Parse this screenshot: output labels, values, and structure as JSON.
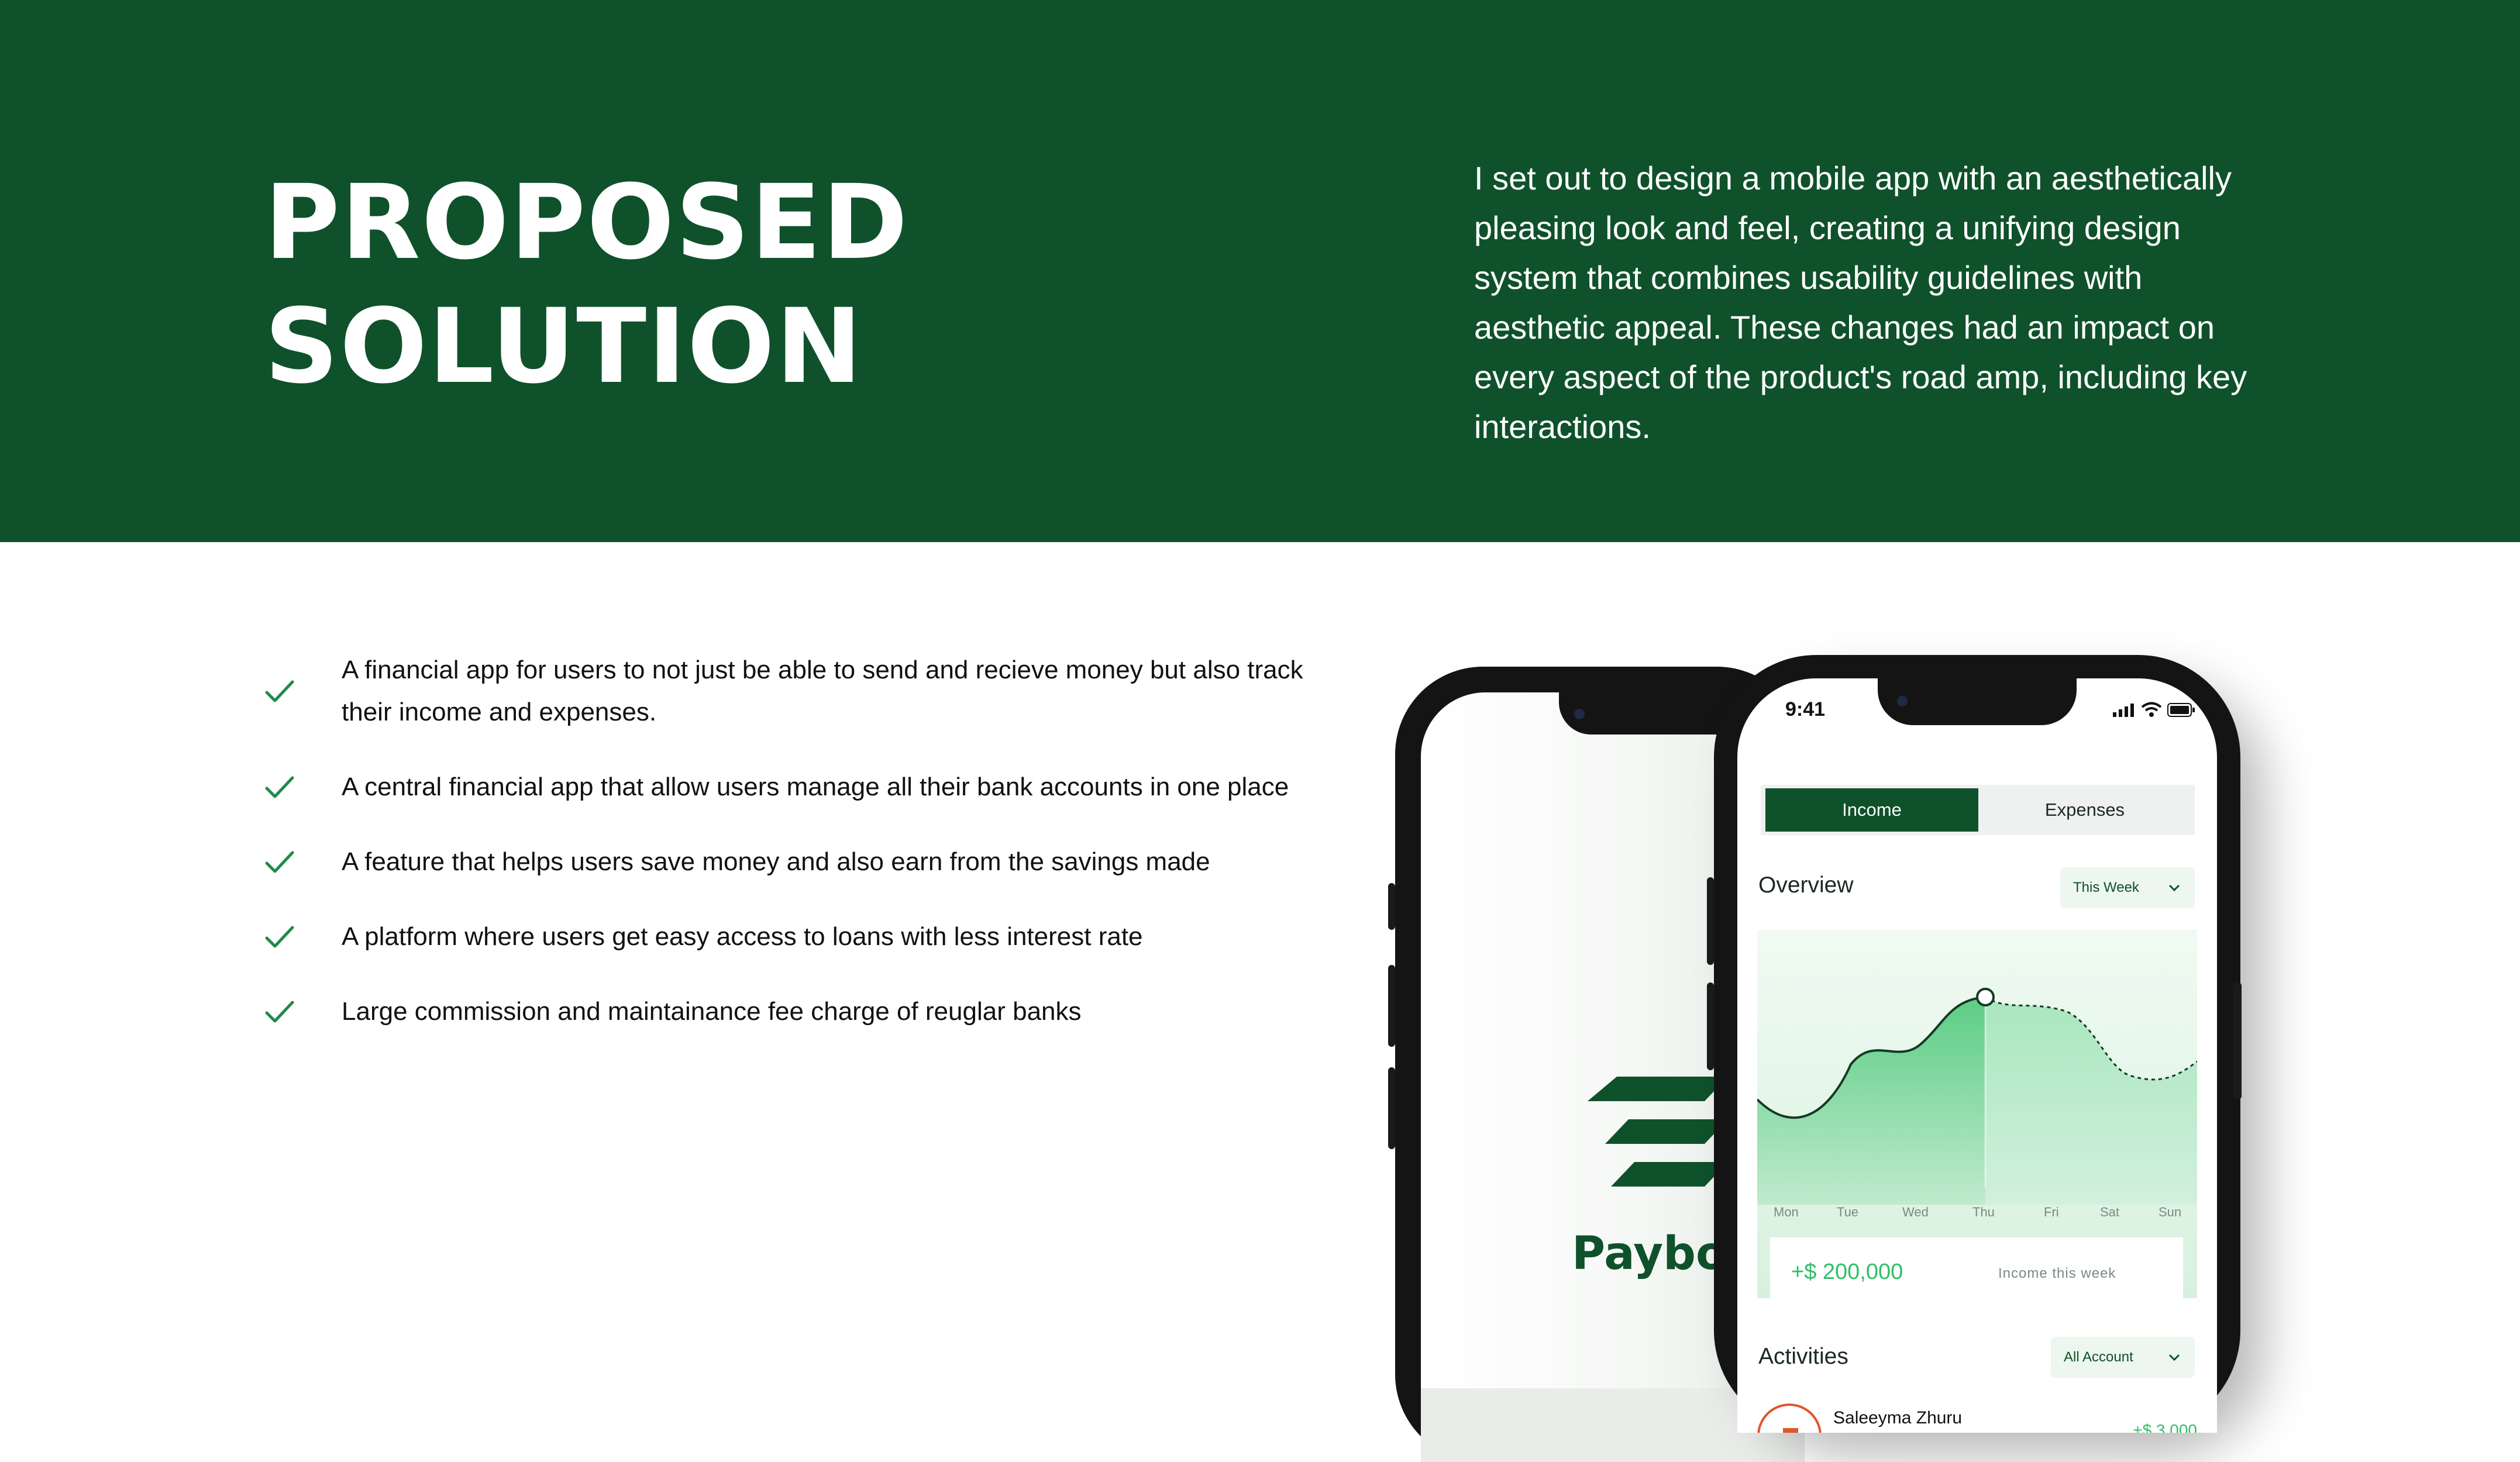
{
  "hero": {
    "title_line1": "PROPOSED",
    "title_line2": "SOLUTION",
    "description": "I set out to design a mobile app with an aesthetically pleasing look and feel, creating a unifying design system that combines usability guidelines with aesthetic appeal. These changes had an impact on every aspect of the product's road amp, including key interactions.",
    "background_color": "#0f512b"
  },
  "features": [
    "A financial app for users to not just be able to send and recieve money but also track their income and expenses.",
    "A central financial app that allow users manage all their bank accounts in one place",
    "A feature that helps users save money and also earn from the savings made",
    "A platform where users get easy access to loans with less interest rate",
    "Large commission and maintainance fee charge of reuglar banks"
  ],
  "check_icon_color": "#1f8a4c",
  "splash_phone": {
    "logo_text": "Paybo",
    "logo_color": "#0f512b"
  },
  "app_phone": {
    "status_time": "9:41",
    "tabs": {
      "income": "Income",
      "expenses": "Expenses"
    },
    "overview_label": "Overview",
    "period_select": "This Week",
    "chart_days": [
      "Mon",
      "Tue",
      "Wed",
      "Thu",
      "Fri",
      "Sat",
      "Sun"
    ],
    "income_amount": "+$ 200,000",
    "income_caption": "Income this week",
    "activities_label": "Activities",
    "account_select": "All Account",
    "activity": {
      "name": "Saleeyma Zhuru",
      "amount": "+$ 3,000"
    },
    "accent_color": "#0f512b",
    "highlight_color": "#2fbf68"
  }
}
